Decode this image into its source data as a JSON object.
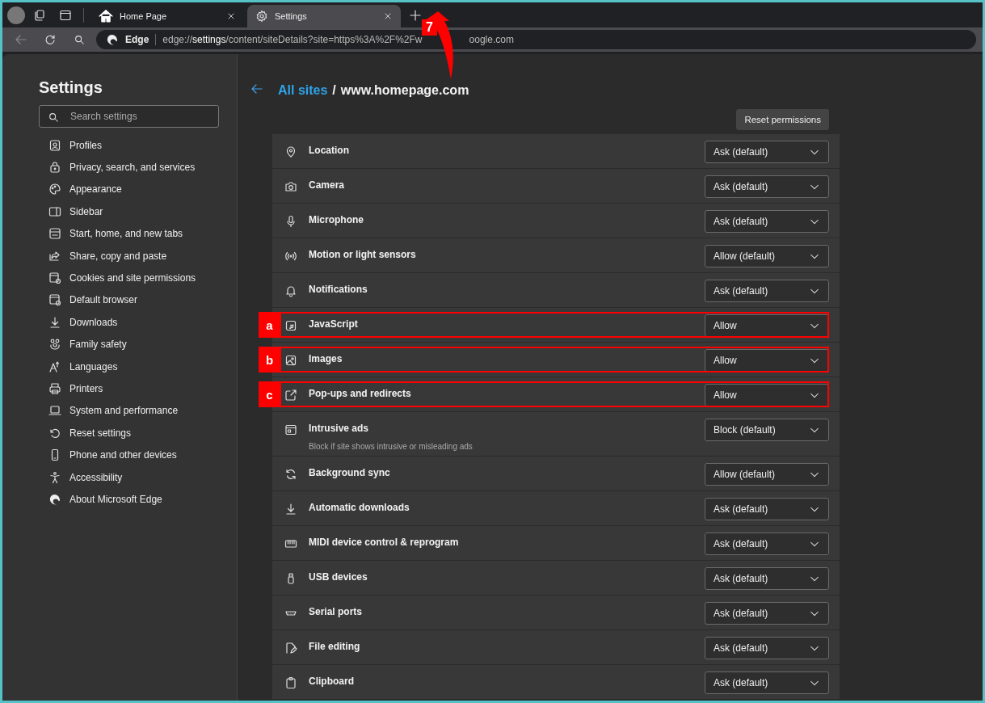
{
  "tabs": [
    {
      "title": "Home Page",
      "selected": false
    },
    {
      "title": "Settings",
      "selected": true
    }
  ],
  "address_bar": {
    "browser_label": "Edge",
    "url_visible": "edge://**settings**/content/siteDetails?site=https%3A%2F%2Fw",
    "url_after_callout": "oogle.com"
  },
  "callout": {
    "number": "7"
  },
  "sidebar": {
    "title": "Settings",
    "search": {
      "placeholder": "Search settings"
    },
    "items": [
      {
        "label": "Profiles"
      },
      {
        "label": "Privacy, search, and services"
      },
      {
        "label": "Appearance"
      },
      {
        "label": "Sidebar"
      },
      {
        "label": "Start, home, and new tabs"
      },
      {
        "label": "Share, copy and paste"
      },
      {
        "label": "Cookies and site permissions"
      },
      {
        "label": "Default browser"
      },
      {
        "label": "Downloads"
      },
      {
        "label": "Family safety"
      },
      {
        "label": "Languages"
      },
      {
        "label": "Printers"
      },
      {
        "label": "System and performance"
      },
      {
        "label": "Reset settings"
      },
      {
        "label": "Phone and other devices"
      },
      {
        "label": "Accessibility"
      },
      {
        "label": "About Microsoft Edge"
      }
    ]
  },
  "breadcrumb": {
    "link": "All sites",
    "separator": "/",
    "current": "www.homepage.com"
  },
  "reset_button": "Reset permissions",
  "permissions": [
    {
      "name": "Location",
      "value": "Ask (default)"
    },
    {
      "name": "Camera",
      "value": "Ask (default)"
    },
    {
      "name": "Microphone",
      "value": "Ask (default)"
    },
    {
      "name": "Motion or light sensors",
      "value": "Allow (default)"
    },
    {
      "name": "Notifications",
      "value": "Ask (default)"
    },
    {
      "name": "JavaScript",
      "value": "Allow",
      "annotation": "a"
    },
    {
      "name": "Images",
      "value": "Allow",
      "annotation": "b"
    },
    {
      "name": "Pop-ups and redirects",
      "value": "Allow",
      "annotation": "c"
    },
    {
      "name": "Intrusive ads",
      "value": "Block (default)",
      "description": "Block if site shows intrusive or misleading ads"
    },
    {
      "name": "Background sync",
      "value": "Allow (default)"
    },
    {
      "name": "Automatic downloads",
      "value": "Ask (default)"
    },
    {
      "name": "MIDI device control & reprogram",
      "value": "Ask (default)"
    },
    {
      "name": "USB devices",
      "value": "Ask (default)"
    },
    {
      "name": "Serial ports",
      "value": "Ask (default)"
    },
    {
      "name": "File editing",
      "value": "Ask (default)"
    },
    {
      "name": "Clipboard",
      "value": "Ask (default)"
    }
  ]
}
